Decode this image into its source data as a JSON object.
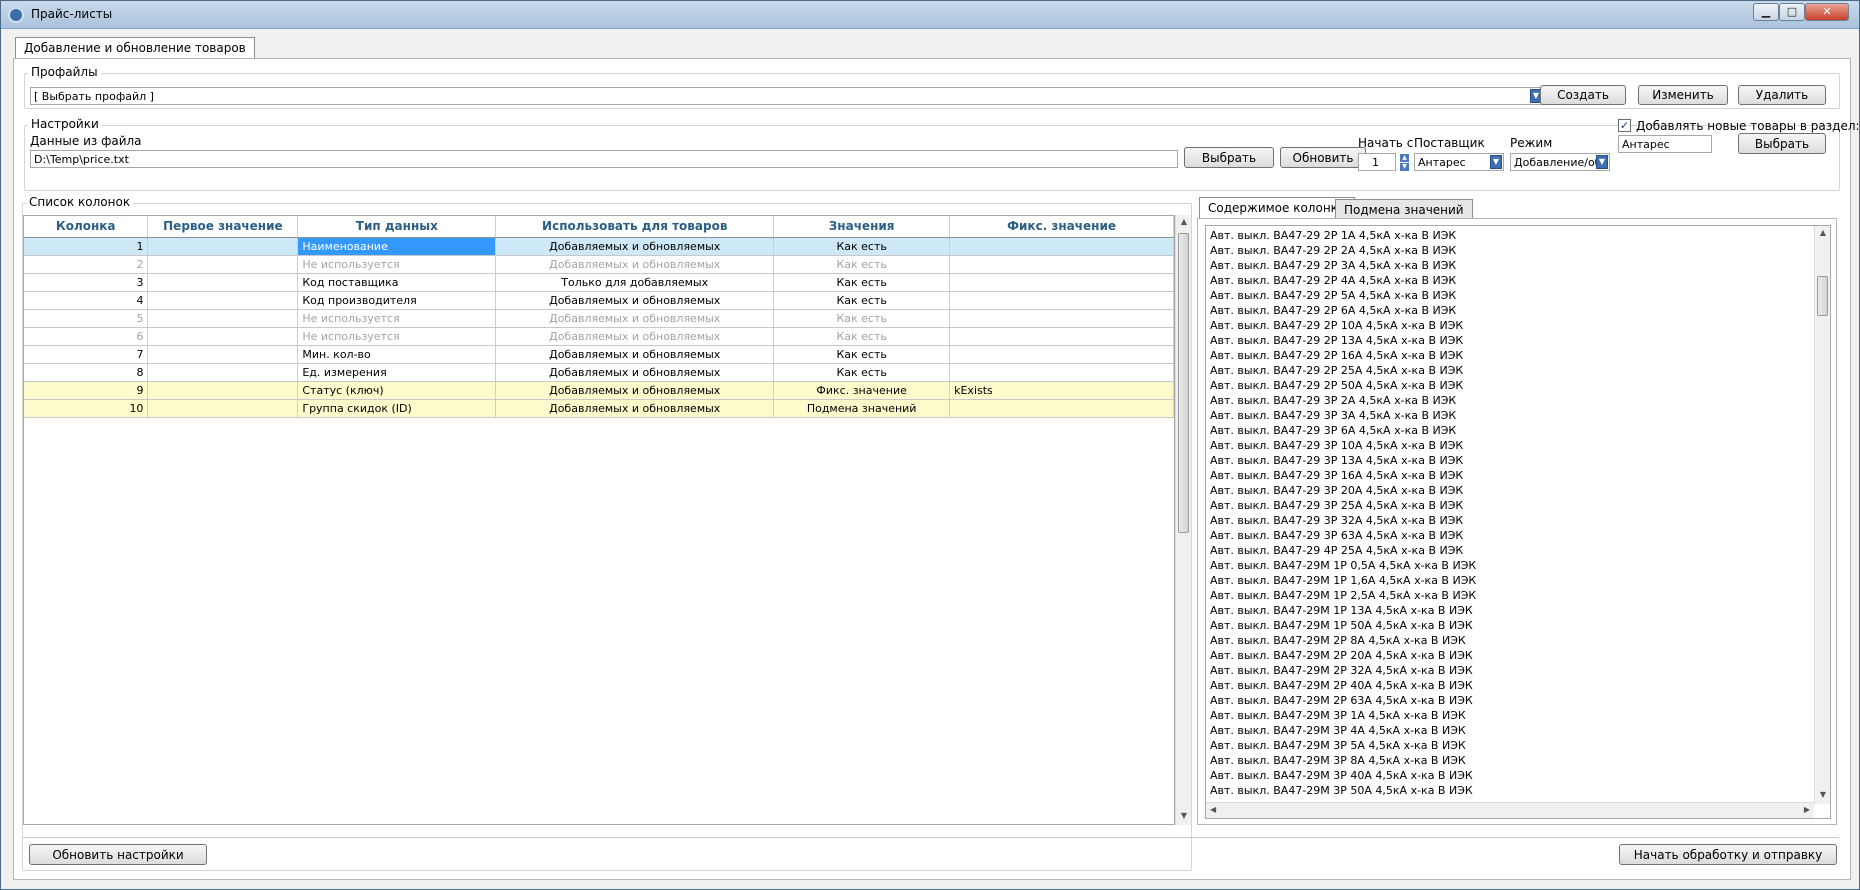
{
  "window": {
    "title": "Прайс-листы"
  },
  "main_tab": "Добавление и обновление товаров",
  "profiles": {
    "label": "Профайлы",
    "selected": "[ Выбрать профайл ]",
    "create_label": "Создать",
    "edit_label": "Изменить",
    "delete_label": "Удалить"
  },
  "settings": {
    "label": "Настройки",
    "file_label": "Данные из файла",
    "file_path": "D:\\Temp\\price.txt",
    "choose_label": "Выбрать",
    "refresh_label": "Обновить",
    "start_label": "Начать с",
    "start_value": "1",
    "supplier_label": "Поставщик",
    "supplier_value": "Антарес",
    "mode_label": "Режим",
    "mode_value": "Добавление/об",
    "add_new_label": "Добавлять новые товары в раздел:",
    "add_new_checked": true,
    "section_value": "Антарес",
    "section_choose_label": "Выбрать"
  },
  "columns_list": {
    "label": "Список колонок",
    "headers": [
      "Колонка",
      "Первое значение",
      "Тип данных",
      "Использовать для товаров",
      "Значения",
      "Фикс. значение"
    ],
    "rows": [
      {
        "col": "1",
        "first": "",
        "type": "Наименование",
        "use": "Добавляемых и обновляемых",
        "values": "Как есть",
        "fixed": "",
        "state": "sel"
      },
      {
        "col": "2",
        "first": "",
        "type": "Не используется",
        "use": "Добавляемых и обновляемых",
        "values": "Как есть",
        "fixed": "",
        "state": "unused"
      },
      {
        "col": "3",
        "first": "",
        "type": "Код поставщика",
        "use": "Только для добавляемых",
        "values": "Как есть",
        "fixed": "",
        "state": ""
      },
      {
        "col": "4",
        "first": "",
        "type": "Код производителя",
        "use": "Добавляемых и обновляемых",
        "values": "Как есть",
        "fixed": "",
        "state": ""
      },
      {
        "col": "5",
        "first": "",
        "type": "Не используется",
        "use": "Добавляемых и обновляемых",
        "values": "Как есть",
        "fixed": "",
        "state": "unused"
      },
      {
        "col": "6",
        "first": "",
        "type": "Не используется",
        "use": "Добавляемых и обновляемых",
        "values": "Как есть",
        "fixed": "",
        "state": "unused"
      },
      {
        "col": "7",
        "first": "",
        "type": "Мин. кол-во",
        "use": "Добавляемых и обновляемых",
        "values": "Как есть",
        "fixed": "",
        "state": ""
      },
      {
        "col": "8",
        "first": "",
        "type": "Ед. измерения",
        "use": "Добавляемых и обновляемых",
        "values": "Как есть",
        "fixed": "",
        "state": ""
      },
      {
        "col": "9",
        "first": "",
        "type": "Статус (ключ)",
        "use": "Добавляемых и обновляемых",
        "values": "Фикс. значение",
        "fixed": "kExists",
        "state": "hl"
      },
      {
        "col": "10",
        "first": "",
        "type": "Группа скидок (ID)",
        "use": "Добавляемых и обновляемых",
        "values": "Подмена значений",
        "fixed": "",
        "state": "hl"
      }
    ]
  },
  "right_tabs": [
    "Содержимое колонки",
    "Подмена значений"
  ],
  "column_content": [
    "Авт. выкл. ВА47-29 2Р  1А 4,5кА х-ка В ИЭК",
    "Авт. выкл. ВА47-29 2Р  2А 4,5кА х-ка В ИЭК",
    "Авт. выкл. ВА47-29 2Р  3А 4,5кА х-ка В ИЭК",
    "Авт. выкл. ВА47-29 2Р  4А 4,5кА х-ка В ИЭК",
    "Авт. выкл. ВА47-29 2Р  5А 4,5кА х-ка В ИЭК",
    "Авт. выкл. ВА47-29 2Р  6А 4,5кА х-ка В ИЭК",
    "Авт. выкл. ВА47-29 2Р 10А 4,5кА х-ка В ИЭК",
    "Авт. выкл. ВА47-29 2Р 13А 4,5кА х-ка В ИЭК",
    "Авт. выкл. ВА47-29 2Р 16А 4,5кА х-ка В ИЭК",
    "Авт. выкл. ВА47-29 2Р 25А 4,5кА х-ка В ИЭК",
    "Авт. выкл. ВА47-29 2Р 50А 4,5кА х-ка В ИЭК",
    "Авт. выкл. ВА47-29 3Р  2А 4,5кА х-ка В ИЭК",
    "Авт. выкл. ВА47-29 3Р  3А 4,5кА х-ка В ИЭК",
    "Авт. выкл. ВА47-29 3Р  6А 4,5кА х-ка В ИЭК",
    "Авт. выкл. ВА47-29 3Р 10А 4,5кА х-ка В ИЭК",
    "Авт. выкл. ВА47-29 3Р 13А 4,5кА х-ка В ИЭК",
    "Авт. выкл. ВА47-29 3Р 16А 4,5кА х-ка В ИЭК",
    "Авт. выкл. ВА47-29 3Р 20А 4,5кА х-ка В ИЭК",
    "Авт. выкл. ВА47-29 3Р 25А 4,5кА х-ка В ИЭК",
    "Авт. выкл. ВА47-29 3Р 32А 4,5кА х-ка В ИЭК",
    "Авт. выкл. ВА47-29 3Р 63А 4,5кА х-ка В ИЭК",
    "Авт. выкл. ВА47-29 4Р 25А 4,5кА х-ка В ИЭК",
    "Авт. выкл. ВА47-29М 1Р  0,5А 4,5кА х-ка В ИЭК",
    "Авт. выкл. ВА47-29М 1Р  1,6А 4,5кА х-ка В ИЭК",
    "Авт. выкл. ВА47-29М 1Р  2,5А 4,5кА х-ка В ИЭК",
    "Авт. выкл. ВА47-29М 1Р 13А 4,5кА х-ка В ИЭК",
    "Авт. выкл. ВА47-29М 1Р 50А 4,5кА х-ка В ИЭК",
    "Авт. выкл. ВА47-29М 2Р  8А 4,5кА х-ка В ИЭК",
    "Авт. выкл. ВА47-29М 2Р 20А 4,5кА х-ка В ИЭК",
    "Авт. выкл. ВА47-29М 2Р 32А 4,5кА х-ка В ИЭК",
    "Авт. выкл. ВА47-29М 2Р 40А 4,5кА х-ка В ИЭК",
    "Авт. выкл. ВА47-29М 2Р 63А 4,5кА х-ка В ИЭК",
    "Авт. выкл. ВА47-29М 3Р  1А 4,5кА х-ка В ИЭК",
    "Авт. выкл. ВА47-29М 3Р  4А 4,5кА х-ка В ИЭК",
    "Авт. выкл. ВА47-29М 3Р  5А 4,5кА х-ка В ИЭК",
    "Авт. выкл. ВА47-29М 3Р  8А 4,5кА х-ка В ИЭК",
    "Авт. выкл. ВА47-29М 3Р 40А 4,5кА х-ка В ИЭК",
    "Авт. выкл. ВА47-29М 3Р 50А 4,5кА х-ка В ИЭК"
  ],
  "footer": {
    "refresh_settings_label": "Обновить настройки",
    "start_processing_label": "Начать обработку и отправку"
  },
  "colors": {
    "header_text": "#2c5f84",
    "selection": "#3399ff",
    "highlight_row": "#fdfbcc"
  },
  "icons": [
    "app-icon",
    "minimize-icon",
    "maximize-icon",
    "close-icon",
    "dropdown-arrow-icon",
    "spin-up-icon",
    "spin-down-icon",
    "checkbox-check-icon",
    "scroll-up-icon",
    "scroll-down-icon",
    "scroll-left-icon",
    "scroll-right-icon"
  ]
}
